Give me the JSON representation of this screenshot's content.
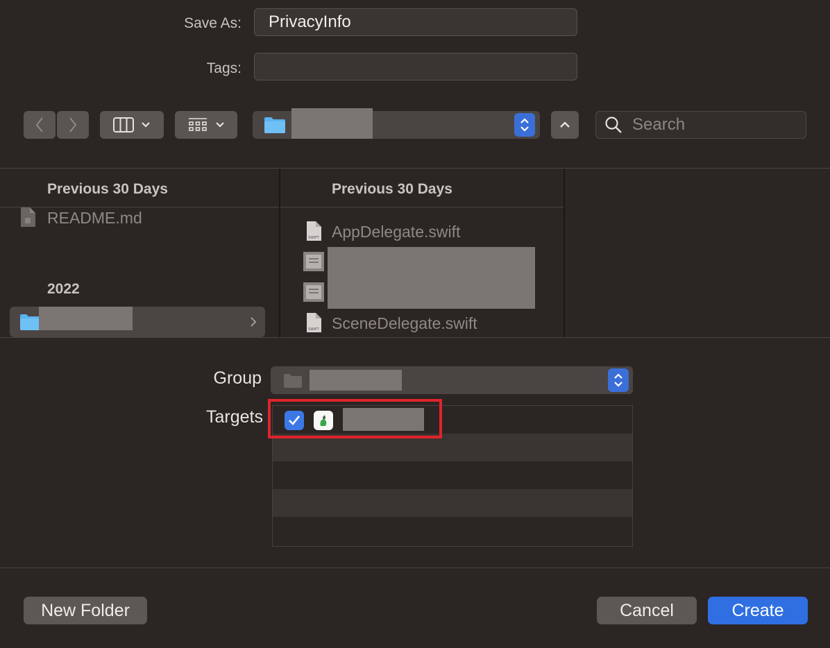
{
  "form": {
    "save_as_label": "Save As:",
    "save_as_value": "PrivacyInfo",
    "tags_label": "Tags:",
    "tags_value": ""
  },
  "toolbar": {
    "back_icon": "chevron-left-icon",
    "forward_icon": "chevron-right-icon",
    "view_columns_icon": "columns-view-icon",
    "group_icon": "icon-grid-icon",
    "location_folder_icon": "folder-icon",
    "up_icon": "chevron-up-icon",
    "search_placeholder": "Search"
  },
  "browser": {
    "column1": {
      "header": "Previous 30 Days",
      "files": [
        {
          "name": "README.md",
          "icon": "document-icon"
        }
      ],
      "section2_header": "2022"
    },
    "column2": {
      "header": "Previous 30 Days",
      "files": [
        {
          "name": "AppDelegate.swift",
          "icon": "swift-file-icon"
        },
        {
          "name": "SceneDelegate.swift",
          "icon": "swift-file-icon"
        }
      ]
    }
  },
  "options": {
    "group_label": "Group",
    "targets_label": "Targets",
    "target_checked": true
  },
  "footer": {
    "new_folder_label": "New Folder",
    "cancel_label": "Cancel",
    "create_label": "Create"
  },
  "colors": {
    "background": "#2b2523",
    "accent": "#2f6fe1",
    "highlight": "#e0232b"
  }
}
